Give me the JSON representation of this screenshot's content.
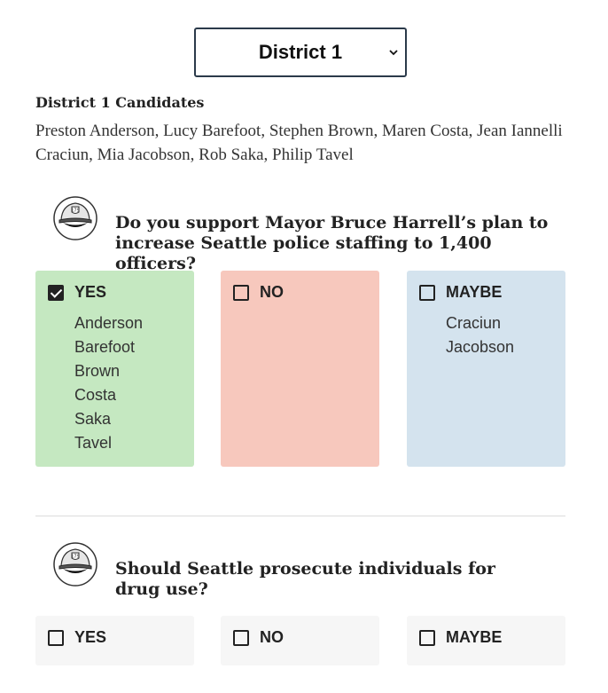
{
  "district_select": {
    "selected": "District 1"
  },
  "candidates": {
    "heading": "District 1 Candidates",
    "list": "Preston Anderson, Lucy Barefoot, Stephen Brown, Maren Costa, Jean Iannelli Craciun, Mia Jacobson, Rob Saka, Philip Tavel"
  },
  "questions": [
    {
      "icon": "police-officer-icon",
      "text": "Do you support Mayor Bruce Harrell’s plan to increase Seattle police staffing to 1,400 officers?",
      "options": [
        {
          "label": "YES",
          "checked": true,
          "color": "#c5e8c1",
          "names": [
            "Anderson",
            "Barefoot",
            "Brown",
            "Costa",
            "Saka",
            "Tavel"
          ]
        },
        {
          "label": "NO",
          "checked": false,
          "color": "#f7c8bd",
          "names": []
        },
        {
          "label": "MAYBE",
          "checked": false,
          "color": "#d4e3ee",
          "names": [
            "Craciun",
            "Jacobson"
          ]
        }
      ]
    },
    {
      "icon": "police-officer-icon",
      "text": "Should Seattle prosecute individuals for drug use?",
      "options": [
        {
          "label": "YES",
          "checked": false,
          "color": "#f6f6f6",
          "names": []
        },
        {
          "label": "NO",
          "checked": false,
          "color": "#f6f6f6",
          "names": []
        },
        {
          "label": "MAYBE",
          "checked": false,
          "color": "#f6f6f6",
          "names": []
        }
      ]
    }
  ]
}
